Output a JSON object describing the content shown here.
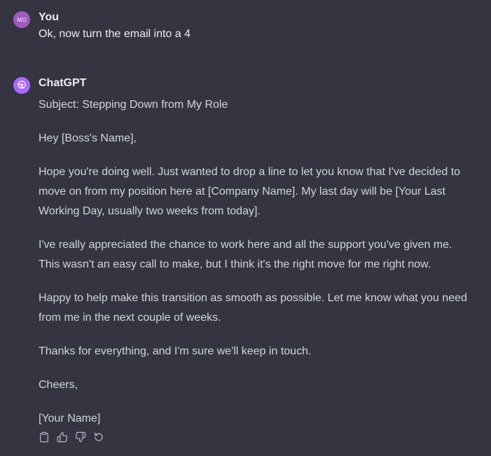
{
  "user": {
    "initials": "MO",
    "name": "You",
    "message": "Ok, now turn the email into a 4"
  },
  "assistant": {
    "name": "ChatGPT",
    "paragraphs": [
      "Subject: Stepping Down from My Role",
      "Hey [Boss's Name],",
      "Hope you're doing well. Just wanted to drop a line to let you know that I've decided to move on from my position here at [Company Name]. My last day will be [Your Last Working Day, usually two weeks from today].",
      "I've really appreciated the chance to work here and all the support you've given me. This wasn't an easy call to make, but I think it's the right move for me right now.",
      "Happy to help make this transition as smooth as possible. Let me know what you need from me in the next couple of weeks.",
      "Thanks for everything, and I'm sure we'll keep in touch.",
      "Cheers,",
      "[Your Name]"
    ],
    "actions": [
      "clipboard-icon",
      "thumbs-up-icon",
      "thumbs-down-icon",
      "regenerate-icon"
    ]
  },
  "colors": {
    "background": "#343541",
    "user_avatar": "#a259c2",
    "assistant_avatar": "#ab68ff",
    "text": "#ececf1",
    "body_text": "#d1d5db"
  }
}
